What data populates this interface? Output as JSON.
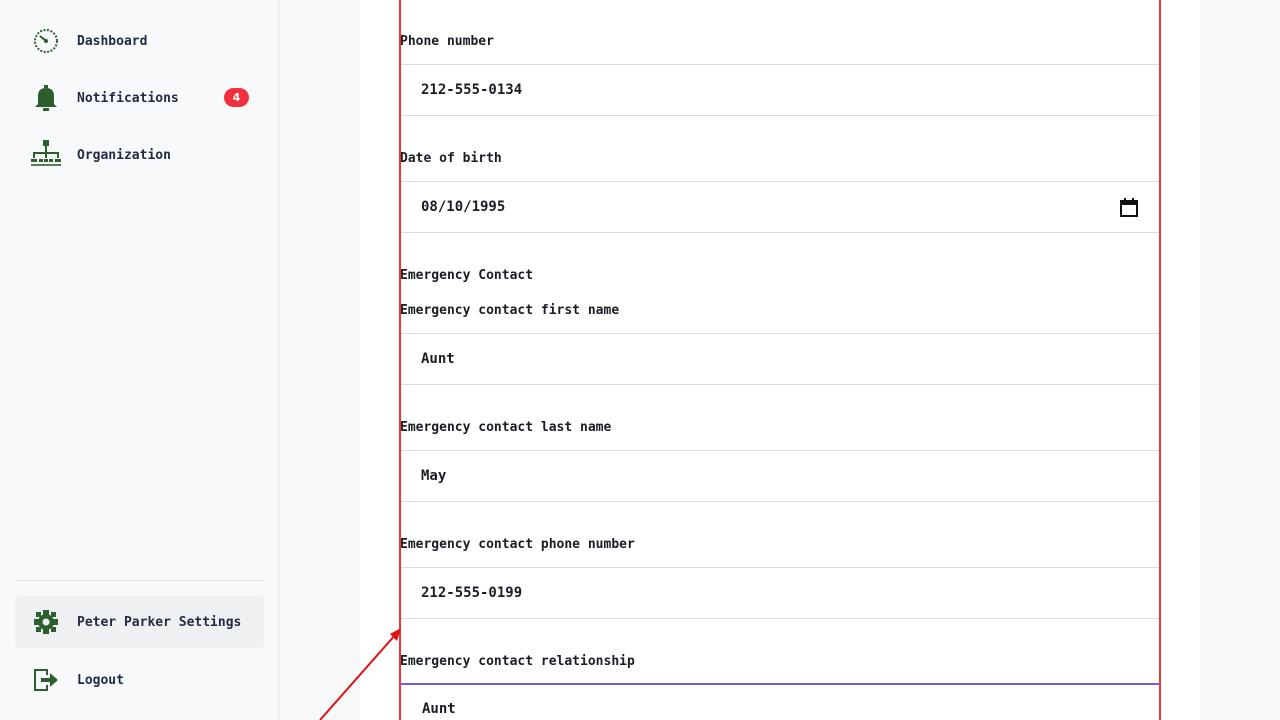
{
  "sidebar": {
    "items": [
      {
        "label": "Dashboard",
        "icon": "dashboard-icon"
      },
      {
        "label": "Notifications",
        "icon": "bell-icon",
        "badge": "4"
      },
      {
        "label": "Organization",
        "icon": "org-chart-icon"
      }
    ],
    "footer": [
      {
        "label": "Peter Parker Settings",
        "icon": "gear-icon",
        "active": true
      },
      {
        "label": "Logout",
        "icon": "logout-icon"
      }
    ]
  },
  "form": {
    "phone": {
      "label": "Phone number",
      "value": "212-555-0134"
    },
    "dob": {
      "label": "Date of birth",
      "value": "08/10/1995"
    },
    "emergency_section": "Emergency Contact",
    "ec_first": {
      "label": "Emergency contact first name",
      "value": "Aunt"
    },
    "ec_last": {
      "label": "Emergency contact last name",
      "value": "May"
    },
    "ec_phone": {
      "label": "Emergency contact phone number",
      "value": "212-555-0199"
    },
    "ec_relationship": {
      "label": "Emergency contact relationship",
      "value": "Aunt"
    }
  },
  "colors": {
    "icon_green": "#2d5e2e",
    "badge_red": "#f4303f",
    "outline_red": "#e53935",
    "focus_blue": "#6c5ce7"
  }
}
